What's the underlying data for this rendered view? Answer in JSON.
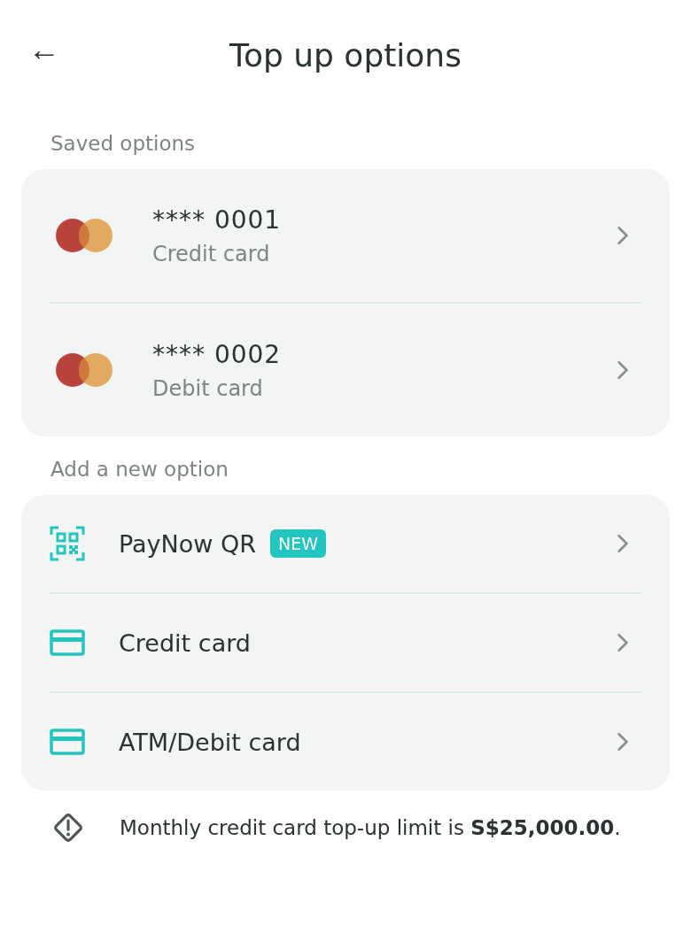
{
  "header": {
    "back_icon": "←",
    "title": "Top up options"
  },
  "saved": {
    "label": "Saved options",
    "items": [
      {
        "number": "**** 0001",
        "type": "Credit card"
      },
      {
        "number": "**** 0002",
        "type": "Debit card"
      }
    ]
  },
  "add_new": {
    "label": "Add a new option",
    "items": [
      {
        "kind": "qr",
        "label": "PayNow QR",
        "badge": "NEW"
      },
      {
        "kind": "card",
        "label": "Credit card"
      },
      {
        "kind": "card",
        "label": "ATM/Debit card"
      }
    ]
  },
  "notice": "Monthly credit card top-up limit is **S$25,000.00**."
}
